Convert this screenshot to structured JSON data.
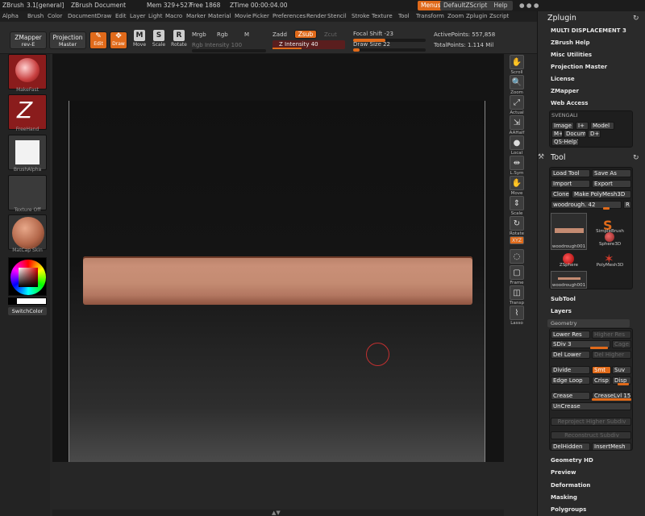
{
  "titlebar": {
    "app": "ZBrush",
    "version": "3.1[general]",
    "document": "ZBrush Document",
    "mem": "Mem 329+527",
    "free": "Free 1868",
    "ztime": "ZTime 00:00:04.00",
    "menus": "Menus",
    "script": "DefaultZScript",
    "help": "Help"
  },
  "menubar": [
    "Alpha",
    "Brush",
    "Color",
    "Document",
    "Draw",
    "Edit",
    "Layer",
    "Light",
    "Macro",
    "Marker",
    "Material",
    "Movie",
    "Picker",
    "Preferences",
    "Render",
    "Stencil",
    "Stroke",
    "Texture",
    "Tool",
    "Transform",
    "Zoom",
    "Zplugin",
    "Zscript"
  ],
  "toolbar": {
    "zmapper": "ZMapper",
    "zmapper_sub": "rev-E",
    "projection": "Projection",
    "projection_sub": "Master",
    "edit": "Edit",
    "draw": "Draw",
    "move": "Move",
    "scale": "Scale",
    "rotate": "Rotate",
    "mrgb": "Mrgb",
    "rgb": "Rgb",
    "m": "M",
    "rgb_intensity": "Rgb Intensity 100",
    "zadd": "Zadd",
    "zsub": "Zsub",
    "zcut": "Zcut",
    "z_intensity": "Z Intensity 40",
    "z_intensity_value": 40,
    "focal_shift": "Focal Shift -23",
    "draw_size": "Draw Size 22",
    "active_points": "ActivePoints: 557,858",
    "total_points": "TotalPoints: 1.114 Mil"
  },
  "leftshelf": {
    "brush": "MakeFast",
    "stroke": "FreeHand",
    "alpha": "BrushAlpha",
    "texture": "Texture Off",
    "material": "MatCap Skin",
    "switch_color": "SwitchColor"
  },
  "rightcol": [
    "Scroll",
    "Zoom",
    "Actual",
    "AAHalf",
    "Local",
    "L.Sym",
    "Move",
    "Scale",
    "Rotate",
    "XYZ",
    "",
    "Frame",
    "Transp",
    "Lasso"
  ],
  "tray": {
    "zplugin_title": "Zplugin",
    "zplugin_items": [
      "MULTI DISPLACEMENT 3",
      "ZBrush Help",
      "Misc Utilities",
      "Projection Master",
      "License",
      "ZMapper",
      "Web Access"
    ],
    "svengali": "SVENGALI",
    "svengali_buttons": [
      "Image",
      "I+",
      "Model",
      "M+",
      "Docum",
      "D+",
      "QS-Help?"
    ],
    "tool_title": "Tool",
    "load_tool": "Load Tool",
    "save_as": "Save As",
    "import": "Import",
    "export": "Export",
    "clone": "Clone",
    "make_polymesh": "Make PolyMesh3D",
    "current_tool": "woodrough. 42",
    "r": "R",
    "thumbs": [
      "woodrough001",
      "SimpleBrush",
      "Sphere3D",
      "ZSphere",
      "PolyMesh3D",
      "woodrough001"
    ],
    "subtool": "SubTool",
    "layers": "Layers",
    "geometry": "Geometry",
    "lower_res": "Lower Res",
    "higher_res": "Higher Res",
    "sdiv": "SDiv 3",
    "cage": "Cage",
    "del_lower": "Del Lower",
    "del_higher": "Del Higher",
    "divide": "Divide",
    "smt": "Smt",
    "suv": "Suv",
    "edge_loop": "Edge Loop",
    "crisp": "Crisp",
    "disp": "Disp",
    "crease": "Crease",
    "crease_lvl": "CreaseLvl 15",
    "uncrease": "UnCrease",
    "reproject": "Reproject Higher Subdiv",
    "reconstruct": "Reconstruct Subdiv",
    "del_hidden": "DelHidden",
    "insert_mesh": "InsertMesh",
    "geometry_hd": "Geometry HD",
    "preview": "Preview",
    "deformation": "Deformation",
    "masking": "Masking",
    "polygroups": "Polygroups"
  }
}
